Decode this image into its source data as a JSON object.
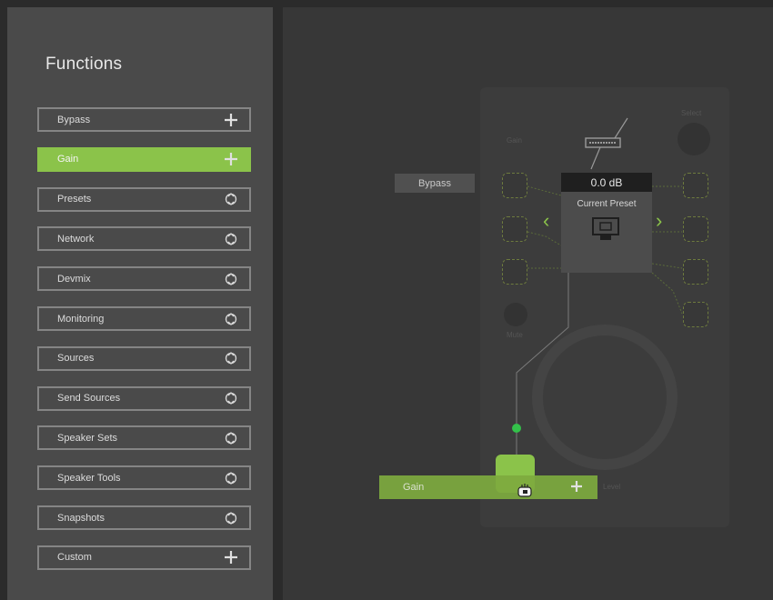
{
  "left_panel": {
    "title": "Functions",
    "items": [
      {
        "label": "Bypass",
        "icon": "plus-icon",
        "active": false
      },
      {
        "label": "Gain",
        "icon": "plus-icon",
        "active": true
      },
      {
        "label": "Presets",
        "icon": "expand-icon",
        "active": false
      },
      {
        "label": "Network",
        "icon": "expand-icon",
        "active": false
      },
      {
        "label": "Devmix",
        "icon": "expand-icon",
        "active": false
      },
      {
        "label": "Monitoring",
        "icon": "expand-icon",
        "active": false
      },
      {
        "label": "Sources",
        "icon": "expand-icon",
        "active": false
      },
      {
        "label": "Send Sources",
        "icon": "expand-icon",
        "active": false
      },
      {
        "label": "Speaker Sets",
        "icon": "expand-icon",
        "active": false
      },
      {
        "label": "Speaker Tools",
        "icon": "expand-icon",
        "active": false
      },
      {
        "label": "Snapshots",
        "icon": "expand-icon",
        "active": false
      },
      {
        "label": "Custom",
        "icon": "plus-icon",
        "active": false
      }
    ]
  },
  "canvas": {
    "bypass_tag": "Bypass",
    "gain_readout": "0.0 dB",
    "current_preset_label": "Current Preset",
    "preset_icon": "display-icon",
    "device_top_right_label": "Select",
    "device_left_label": "Gain",
    "device_mute_label": "Mute",
    "device_bottom_label": "Level",
    "drag_ghost_label": "Gain",
    "drag_ghost_icon": "plus-icon",
    "cursor_icon": "drag-hand-cursor-icon"
  },
  "colors": {
    "accent": "#8bc34a",
    "connector": "#33c14a",
    "panel": "#4a4a4a",
    "canvas": "#373737"
  }
}
